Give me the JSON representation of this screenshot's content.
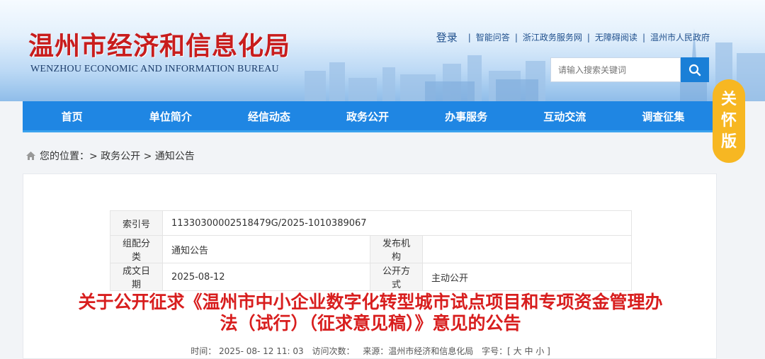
{
  "header": {
    "title_cn": "温州市经济和信息化局",
    "title_en": "WENZHOU ECONOMIC AND INFORMATION BUREAU",
    "login": "登录",
    "links": [
      "智能问答",
      "浙江政务服务网",
      "无障碍阅读",
      "温州市人民政府"
    ],
    "search_placeholder": "请输入搜索关键词"
  },
  "nav": [
    "首页",
    "单位简介",
    "经信动态",
    "政务公开",
    "办事服务",
    "互动交流",
    "调查征集"
  ],
  "care": [
    "关",
    "怀",
    "版"
  ],
  "breadcrumb": {
    "label": "您的位置：",
    "path": "> 政务公开 > 通知公告"
  },
  "meta": {
    "index_label": "索引号",
    "index_value": "11330300002518479G/2025-1010389067",
    "category_label": "组配分类",
    "category_value": "通知公告",
    "publisher_label": "发布机构",
    "publisher_value": "",
    "date_label": "成文日期",
    "date_value": "2025-08-12",
    "open_label": "公开方式",
    "open_value": "主动公开"
  },
  "article": {
    "title_line1": "关于公开征求《温州市中小企业数字化转型城市试点项目和专项资金管理办",
    "title_line2": "法（试行）（征求意见稿）》意见的公告",
    "time": "时间：  2025- 08- 12 11: 03",
    "visits": "访问次数：",
    "source": "来源：温州市经济和信息化局",
    "fontsize": "字号：[ 大 中 小 ]"
  },
  "colors": {
    "accent": "#1f86e3",
    "title_red": "#d81e1e",
    "care_badge": "#f7b722"
  }
}
